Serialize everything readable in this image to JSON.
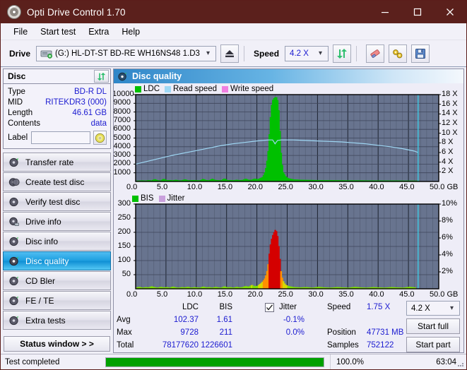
{
  "window": {
    "title": "Opti Drive Control 1.70",
    "icon": "disc-icon",
    "minimize": "minimize-icon",
    "maximize": "maximize-icon",
    "close": "close-icon"
  },
  "menu": {
    "items": [
      "File",
      "Start test",
      "Extra",
      "Help"
    ]
  },
  "toolbar": {
    "drive_label": "Drive",
    "drive_value": "(G:)  HL-DT-ST BD-RE  WH16NS48 1.D3",
    "eject_icon": "eject-icon",
    "speed_label": "Speed",
    "speed_value": "4.2 X",
    "refresh_icon": "refresh-icon",
    "erase_icon": "eraser-icon",
    "tools_icon": "tools-icon",
    "save_icon": "save-icon"
  },
  "disc": {
    "header": "Disc",
    "refresh_icon": "refresh-icon",
    "rows": [
      {
        "key": "Type",
        "value": "BD-R DL"
      },
      {
        "key": "MID",
        "value": "RITEKDR3 (000)"
      },
      {
        "key": "Length",
        "value": "46.61 GB"
      },
      {
        "key": "Contents",
        "value": "data"
      }
    ],
    "label_key": "Label",
    "label_value": "",
    "label_placeholder": "",
    "disc_icon": "cd-icon"
  },
  "nav": {
    "items": [
      {
        "label": "Transfer rate",
        "icon": "disc-icon",
        "selected": false
      },
      {
        "label": "Create test disc",
        "icon": "disc-icon",
        "selected": false
      },
      {
        "label": "Verify test disc",
        "icon": "disc-icon",
        "selected": false
      },
      {
        "label": "Drive info",
        "icon": "disc-icon",
        "selected": false
      },
      {
        "label": "Disc info",
        "icon": "disc-icon",
        "selected": false
      },
      {
        "label": "Disc quality",
        "icon": "disc-icon",
        "selected": true
      },
      {
        "label": "CD Bler",
        "icon": "disc-icon",
        "selected": false
      },
      {
        "label": "FE / TE",
        "icon": "disc-icon",
        "selected": false
      },
      {
        "label": "Extra tests",
        "icon": "disc-icon",
        "selected": false
      }
    ],
    "status_window": "Status window > >"
  },
  "panel": {
    "title": "Disc quality",
    "icon": "disc-icon"
  },
  "stats": {
    "col_ldc": "LDC",
    "col_bis": "BIS",
    "jitter_label": "Jitter",
    "jitter_checked": true,
    "rows": [
      {
        "key": "Avg",
        "ldc": "102.37",
        "bis": "1.61",
        "jitter": "-0.1%"
      },
      {
        "key": "Max",
        "ldc": "9728",
        "bis": "211",
        "jitter": "0.0%"
      },
      {
        "key": "Total",
        "ldc": "78177620",
        "bis": "1226601",
        "jitter": ""
      }
    ],
    "speed_key": "Speed",
    "speed_value": "1.75 X",
    "position_key": "Position",
    "position_value": "47731 MB",
    "samples_key": "Samples",
    "samples_value": "752122",
    "speed_select": "4.2 X",
    "start_full": "Start full",
    "start_part": "Start part"
  },
  "statusbar": {
    "text": "Test completed",
    "percent": "100.0%",
    "progress": 100,
    "time": "63:04"
  },
  "colors": {
    "title_bar": "#5b201c",
    "accent_blue": "#1b1bd0",
    "plot_bg": "#68748f",
    "ldc_green": "#00c000",
    "bis_green": "#00c000",
    "read_speed": "#9fd8f5",
    "write_speed": "#ef7fe0",
    "jitter": "#c9a0dc",
    "progress_green": "#00a000",
    "selection": "#1e9fe0"
  },
  "chart_data": [
    {
      "type": "area",
      "name": "ldc-chart",
      "title": "",
      "xlabel": "GB",
      "ylabel": "",
      "xlim": [
        0,
        50
      ],
      "ylim": [
        0,
        10000
      ],
      "y2lim": [
        0,
        18
      ],
      "grid": true,
      "legend_position": "top-left",
      "legend": [
        "LDC",
        "Read speed",
        "Write speed"
      ],
      "yticks": [
        1000,
        2000,
        3000,
        4000,
        5000,
        6000,
        7000,
        8000,
        9000,
        10000
      ],
      "yticklabels": [
        "1000",
        "2000",
        "3000",
        "4000",
        "5000",
        "6000",
        "7000",
        "8000",
        "9000",
        "10000"
      ],
      "y2ticks": [
        2,
        4,
        6,
        8,
        10,
        12,
        14,
        16,
        18
      ],
      "y2ticklabels": [
        "2 X",
        "4 X",
        "6 X",
        "8 X",
        "10 X",
        "12 X",
        "14 X",
        "16 X",
        "18 X"
      ],
      "xticks": [
        0,
        5,
        10,
        15,
        20,
        25,
        30,
        35,
        40,
        45,
        50
      ],
      "xticklabels": [
        "0.0",
        "5.0",
        "10.0",
        "15.0",
        "20.0",
        "25.0",
        "30.0",
        "35.0",
        "40.0",
        "45.0",
        "50.0"
      ],
      "series": [
        {
          "name": "LDC",
          "color": "#00c000",
          "x": [
            0,
            0.5,
            1,
            1.5,
            2,
            2.5,
            3,
            3.5,
            4,
            4.5,
            5,
            5.5,
            6,
            6.5,
            7,
            7.5,
            8,
            8.5,
            9,
            9.5,
            10,
            10.5,
            11,
            11.5,
            12,
            12.5,
            13,
            13.5,
            14,
            14.5,
            15,
            15.5,
            16,
            16.5,
            17,
            17.5,
            18,
            18.5,
            19,
            19.5,
            20,
            20.4,
            20.8,
            21.1,
            21.4,
            21.7,
            21.9,
            22.1,
            22.3,
            22.5,
            22.7,
            22.9,
            23.05,
            23.2,
            23.35,
            23.5,
            23.7,
            23.9,
            24.2,
            24.6,
            25,
            25.5,
            26,
            27,
            28,
            29,
            30,
            31,
            32,
            33,
            34,
            35,
            36,
            37,
            38,
            39,
            40,
            41,
            42,
            43,
            44,
            45,
            46,
            46.6
          ],
          "y": [
            90,
            110,
            130,
            95,
            160,
            120,
            280,
            140,
            110,
            320,
            150,
            170,
            130,
            200,
            120,
            140,
            260,
            130,
            150,
            170,
            140,
            130,
            300,
            160,
            140,
            310,
            180,
            150,
            140,
            360,
            150,
            170,
            140,
            200,
            150,
            180,
            330,
            190,
            200,
            340,
            260,
            380,
            520,
            900,
            1700,
            3200,
            5200,
            7300,
            8800,
            9400,
            9600,
            9720,
            9728,
            9600,
            9100,
            7900,
            5200,
            2600,
            1100,
            600,
            380,
            300,
            240,
            200,
            180,
            170,
            160,
            150,
            150,
            140,
            140,
            130,
            130,
            130,
            120,
            120,
            120,
            110,
            110,
            110,
            100,
            100,
            100,
            90
          ]
        },
        {
          "name": "Read speed",
          "color": "#9fd8f5",
          "x": [
            0,
            2,
            4,
            6,
            8,
            10,
            12,
            14,
            16,
            18,
            20,
            21,
            22,
            22.6,
            23,
            23.4,
            24,
            26,
            28,
            30,
            32,
            34,
            36,
            38,
            40,
            42,
            44,
            46,
            46.6
          ],
          "y_x": [
            3.6,
            4.2,
            4.8,
            5.4,
            5.9,
            6.4,
            6.9,
            7.4,
            7.8,
            8.1,
            8.4,
            8.5,
            8.6,
            8.6,
            7.8,
            8.5,
            8.6,
            8.6,
            8.5,
            8.4,
            8.3,
            8.2,
            8.0,
            7.8,
            7.5,
            7.2,
            6.8,
            6.3,
            6.0
          ]
        },
        {
          "name": "Write speed",
          "color": "#ef7fe0",
          "x": [],
          "y": []
        }
      ],
      "markers": [
        {
          "name": "disc-end",
          "x": 46.6,
          "color": "#38d6f2"
        }
      ]
    },
    {
      "type": "area",
      "name": "bis-chart",
      "title": "",
      "xlabel": "GB",
      "ylabel": "",
      "xlim": [
        0,
        50
      ],
      "ylim": [
        0,
        300
      ],
      "y2lim": [
        0,
        10
      ],
      "grid": true,
      "legend_position": "top-left",
      "legend": [
        "BIS",
        "Jitter"
      ],
      "yticks": [
        50,
        100,
        150,
        200,
        250,
        300
      ],
      "yticklabels": [
        "50",
        "100",
        "150",
        "200",
        "250",
        "300"
      ],
      "y2ticks": [
        2,
        4,
        6,
        8,
        10
      ],
      "y2ticklabels": [
        "2%",
        "4%",
        "6%",
        "8%",
        "10%"
      ],
      "xticks": [
        0,
        5,
        10,
        15,
        20,
        25,
        30,
        35,
        40,
        45,
        50
      ],
      "xticklabels": [
        "0.0",
        "5.0",
        "10.0",
        "15.0",
        "20.0",
        "25.0",
        "30.0",
        "35.0",
        "40.0",
        "45.0",
        "50.0"
      ],
      "series": [
        {
          "name": "BIS",
          "color": "#00c000",
          "x": [
            0,
            0.5,
            1,
            1.5,
            2,
            2.5,
            3,
            3.5,
            4,
            4.5,
            5,
            5.5,
            6,
            6.5,
            7,
            7.5,
            8,
            8.5,
            9,
            9.5,
            10,
            10.5,
            11,
            11.5,
            12,
            12.5,
            13,
            13.5,
            14,
            14.5,
            15,
            15.5,
            16,
            16.5,
            17,
            17.5,
            18,
            18.5,
            19,
            19.5,
            20,
            20.3,
            20.6,
            20.9,
            21.2,
            21.5,
            21.8,
            22,
            22.2,
            22.4,
            22.6,
            22.8,
            22.95,
            23.1,
            23.25,
            23.4,
            23.6,
            23.8,
            24.1,
            24.5,
            25,
            25.5,
            26,
            27,
            28,
            29,
            30,
            31,
            32,
            33,
            34,
            35,
            36,
            37,
            38,
            39,
            40,
            41,
            42,
            43,
            44,
            45,
            46,
            46.6
          ],
          "y": [
            5,
            7,
            4,
            6,
            5,
            9,
            6,
            4,
            7,
            5,
            6,
            4,
            8,
            5,
            4,
            6,
            5,
            7,
            4,
            6,
            5,
            4,
            8,
            5,
            6,
            4,
            7,
            5,
            4,
            9,
            5,
            6,
            4,
            7,
            5,
            6,
            10,
            7,
            14,
            9,
            11,
            16,
            21,
            28,
            38,
            58,
            96,
            142,
            168,
            185,
            196,
            205,
            211,
            203,
            190,
            165,
            120,
            68,
            32,
            16,
            10,
            8,
            6,
            5,
            6,
            4,
            7,
            5,
            4,
            6,
            5,
            4,
            7,
            5,
            4,
            6,
            5,
            4,
            6,
            5,
            4,
            7,
            5
          ]
        },
        {
          "name": "Jitter",
          "color": "#c9a0dc",
          "x": [],
          "y": []
        }
      ],
      "markers": [
        {
          "name": "disc-end",
          "x": 46.6,
          "color": "#38d6f2"
        }
      ]
    }
  ]
}
